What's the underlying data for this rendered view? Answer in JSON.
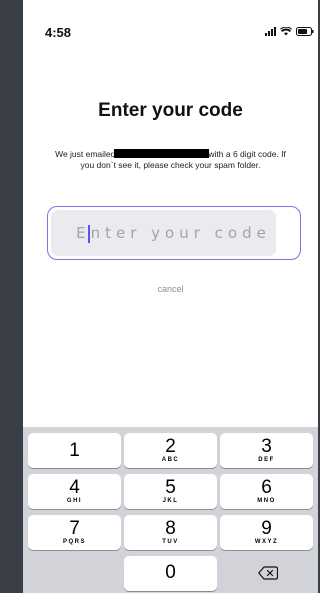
{
  "status_bar": {
    "time": "4:58"
  },
  "screen": {
    "title": "Enter your code",
    "description_before": "We just emailed",
    "description_after": "with a 6 digit code. If you don`t see it, please check your spam folder.",
    "input_placeholder": "Enter your code",
    "cancel_label": "cancel"
  },
  "keypad": {
    "keys": [
      {
        "num": "1",
        "letters": ""
      },
      {
        "num": "2",
        "letters": "ABC"
      },
      {
        "num": "3",
        "letters": "DEF"
      },
      {
        "num": "4",
        "letters": "GHI"
      },
      {
        "num": "5",
        "letters": "JKL"
      },
      {
        "num": "6",
        "letters": "MNO"
      },
      {
        "num": "7",
        "letters": "PQRS"
      },
      {
        "num": "8",
        "letters": "TUV"
      },
      {
        "num": "9",
        "letters": "WXYZ"
      },
      {
        "num": "0",
        "letters": ""
      }
    ],
    "delete_icon": "delete-backspace-icon"
  },
  "colors": {
    "accent": "#7b74e6",
    "background_frame": "#3a3f47",
    "keyboard_bg": "#d1d3d9"
  }
}
